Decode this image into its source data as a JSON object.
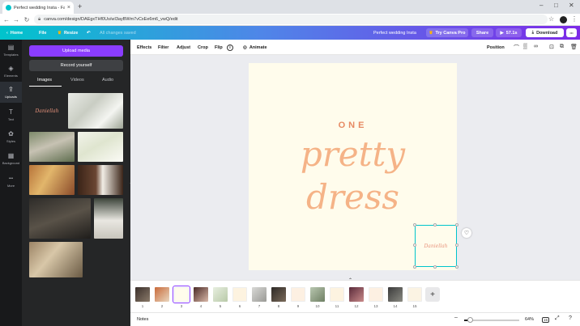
{
  "browser": {
    "tab_title": "Perfect wedding Insta - Faceb",
    "tab_close": "×",
    "new_tab": "+",
    "url": "canva.com/design/DAEgxTHf0Us/wI3ayBWm7vCxEe6m6_vwQ/edit",
    "win_min": "–",
    "win_max": "□",
    "win_close": "✕"
  },
  "header": {
    "home": "Home",
    "file": "File",
    "resize": "Resize",
    "status": "All changes saved",
    "doc_title": "Perfect wedding Insta",
    "try_pro": "Try Canva Pro",
    "share": "Share",
    "play_time": "57.1s",
    "download": "Download",
    "more": "•••"
  },
  "rail": [
    {
      "label": "Templates",
      "icon": "▤"
    },
    {
      "label": "Elements",
      "icon": "◈"
    },
    {
      "label": "Uploads",
      "icon": "⇪"
    },
    {
      "label": "Text",
      "icon": "T"
    },
    {
      "label": "Styles",
      "icon": "✿"
    },
    {
      "label": "Background",
      "icon": "▦"
    },
    {
      "label": "More",
      "icon": "•••"
    }
  ],
  "panel": {
    "upload_button": "Upload media",
    "record_button": "Record yourself",
    "tabs": [
      "Images",
      "Videos",
      "Audio"
    ],
    "thumbnail_signature": "Daniellah"
  },
  "toolbar": {
    "effects": "Effects",
    "filter": "Filter",
    "adjust": "Adjust",
    "crop": "Crop",
    "flip": "Flip",
    "animate": "Animate",
    "position": "Position"
  },
  "design": {
    "line1": "ONE",
    "line2": "pretty",
    "line3": "dress",
    "signature": "Daniellah"
  },
  "pages": [
    "1",
    "2",
    "3",
    "4",
    "5",
    "6",
    "7",
    "8",
    "9",
    "10",
    "11",
    "12",
    "13",
    "14",
    "15"
  ],
  "selected_page": 3,
  "footer": {
    "notes": "Notes",
    "zoom": "64%",
    "zoom_fraction": 0.64,
    "page_count": "15"
  }
}
